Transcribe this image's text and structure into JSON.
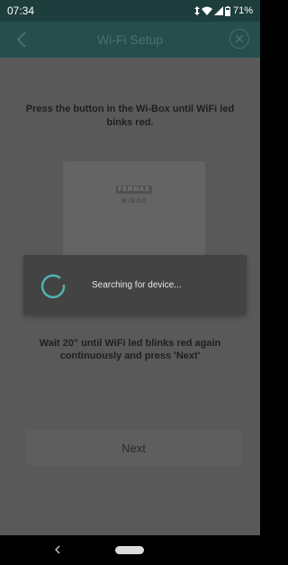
{
  "status_bar": {
    "time": "07:34",
    "battery": "71%",
    "icons": [
      "data-transfer-icon",
      "wifi-icon",
      "signal-icon",
      "battery-icon"
    ]
  },
  "app_bar": {
    "title": "Wi-Fi Setup",
    "back_icon": "chevron-left-icon",
    "close_icon": "close-circle-icon"
  },
  "main": {
    "instruction": "Press the button in the Wi-Box until WiFi led binks red.",
    "device_logo_brand": "FERMAX",
    "device_logo_product": "WiBOX",
    "wait_text": "Wait 20\" until WiFi led blinks red again continuously and press 'Next'",
    "next_label": "Next"
  },
  "dialog": {
    "message": "Searching for device...",
    "icon": "spinner-icon"
  },
  "colors": {
    "app_bar": "#264e4d",
    "status_bar": "#1d3e3c",
    "dim_content": "#595959",
    "dialog_bg": "#434343",
    "spinner": "#4fb3b0"
  }
}
